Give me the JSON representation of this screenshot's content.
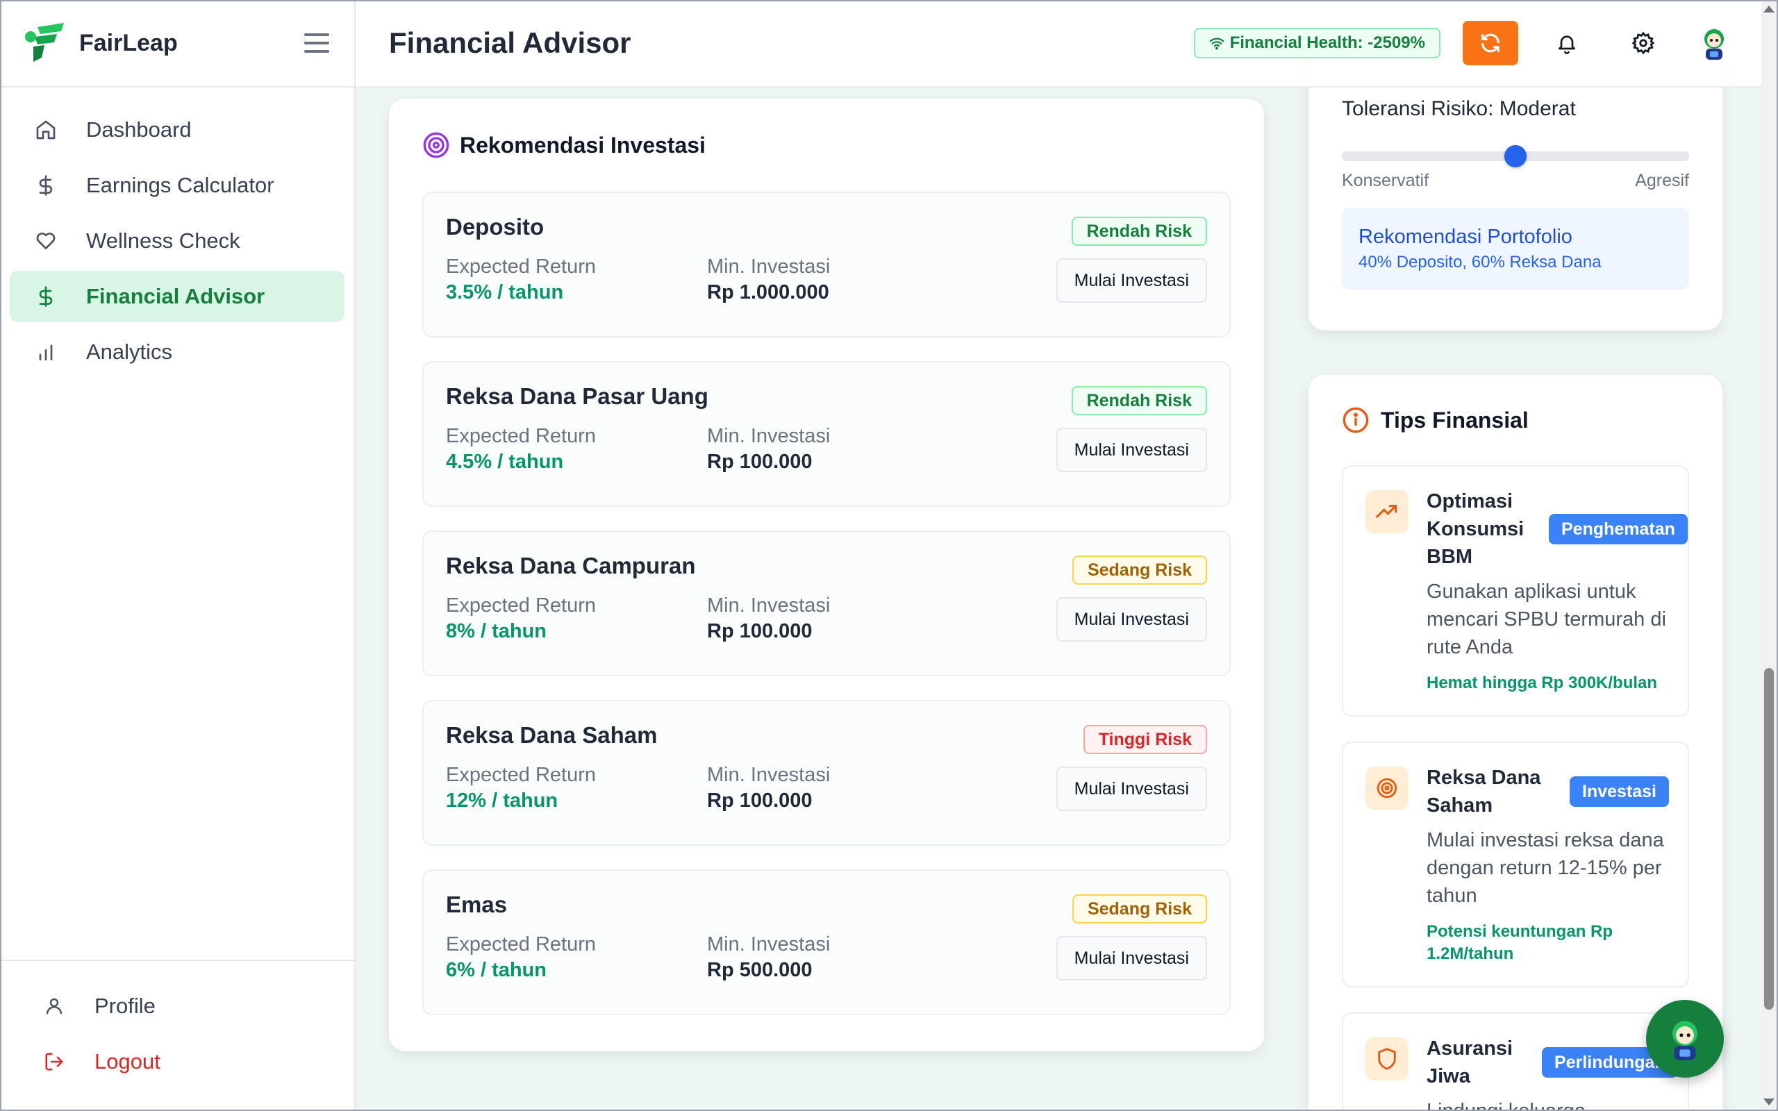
{
  "brand": {
    "name": "FairLeap"
  },
  "sidebar": {
    "items": [
      {
        "label": "Dashboard",
        "icon": "home-icon",
        "active": false
      },
      {
        "label": "Earnings Calculator",
        "icon": "dollar-icon",
        "active": false
      },
      {
        "label": "Wellness Check",
        "icon": "heart-icon",
        "active": false
      },
      {
        "label": "Financial Advisor",
        "icon": "dollar-icon",
        "active": true
      },
      {
        "label": "Analytics",
        "icon": "bar-chart-icon",
        "active": false
      }
    ],
    "bottom": {
      "profile": "Profile",
      "logout": "Logout"
    }
  },
  "header": {
    "title": "Financial Advisor",
    "health_badge": "Financial Health: -2509%"
  },
  "investments": {
    "title": "Rekomendasi Investasi",
    "return_label": "Expected Return",
    "min_label": "Min. Investasi",
    "button_label": "Mulai Investasi",
    "items": [
      {
        "name": "Deposito",
        "risk": "Rendah Risk",
        "risk_level": "low",
        "return": "3.5% / tahun",
        "min": "Rp 1.000.000"
      },
      {
        "name": "Reksa Dana Pasar Uang",
        "risk": "Rendah Risk",
        "risk_level": "low",
        "return": "4.5% / tahun",
        "min": "Rp 100.000"
      },
      {
        "name": "Reksa Dana Campuran",
        "risk": "Sedang Risk",
        "risk_level": "med",
        "return": "8% / tahun",
        "min": "Rp 100.000"
      },
      {
        "name": "Reksa Dana Saham",
        "risk": "Tinggi Risk",
        "risk_level": "high",
        "return": "12% / tahun",
        "min": "Rp 100.000"
      },
      {
        "name": "Emas",
        "risk": "Sedang Risk",
        "risk_level": "med",
        "return": "6% / tahun",
        "min": "Rp 500.000"
      }
    ]
  },
  "risk_tolerance": {
    "title": "Toleransi Risiko: Moderat",
    "slider_value": 0.5,
    "min_label": "Konservatif",
    "max_label": "Agresif",
    "portfolio_title": "Rekomendasi Portofolio",
    "portfolio_desc": "40% Deposito, 60% Reksa Dana"
  },
  "tips": {
    "title": "Tips Finansial",
    "items": [
      {
        "title": "Optimasi Konsumsi BBM",
        "tag": "Penghematan",
        "icon": "trending-up-icon",
        "desc": "Gunakan aplikasi untuk mencari SPBU termurah di rute Anda",
        "saving": "Hemat hingga Rp 300K/bulan"
      },
      {
        "title": "Reksa Dana Saham",
        "tag": "Investasi",
        "icon": "target-icon",
        "desc": "Mulai investasi reksa dana dengan return 12-15% per tahun",
        "saving": "Potensi keuntungan Rp 1.2M/tahun"
      },
      {
        "title": "Asuransi Jiwa",
        "tag": "Perlindungan",
        "icon": "shield-icon",
        "desc": "Lindungi keluarga",
        "saving": ""
      }
    ]
  },
  "colors": {
    "brand_green": "#15803d",
    "accent_orange": "#f97316",
    "tag_blue": "#3b82f6",
    "return_green": "#059669"
  }
}
